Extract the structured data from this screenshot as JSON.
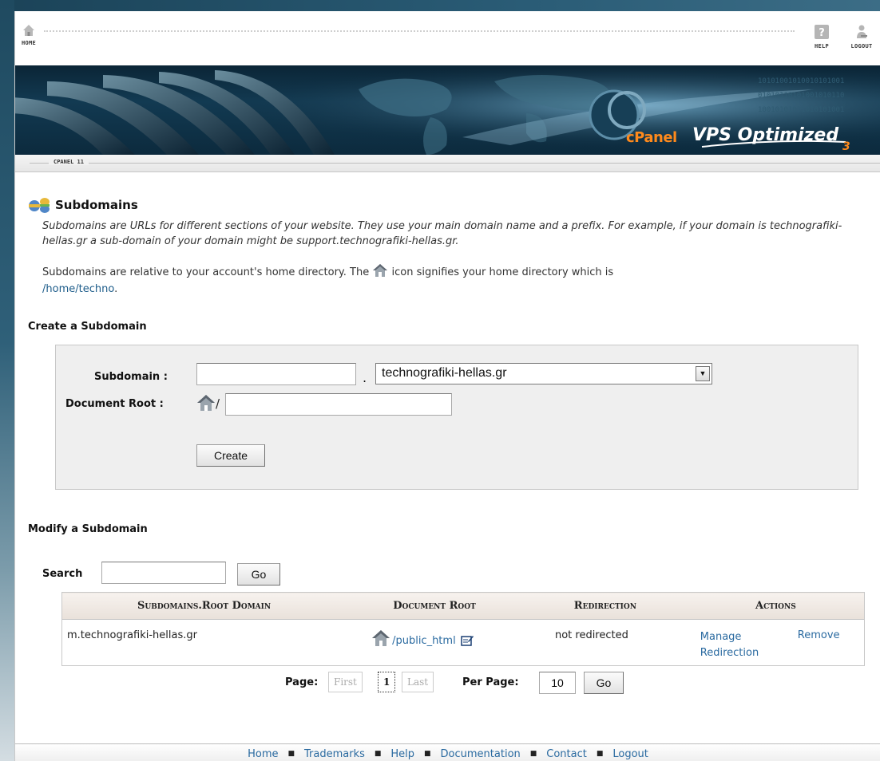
{
  "nav": {
    "home_label": "HOME",
    "help_label": "HELP",
    "logout_label": "LOGOUT"
  },
  "banner": {
    "brand": "cPanel",
    "product": "VPS Optimized",
    "version": "3"
  },
  "version_bar": {
    "label": "CPANEL 11"
  },
  "page": {
    "title": "Subdomains",
    "description": "Subdomains are URLs for different sections of your website. They use your main domain name and a prefix. For example, if your domain is technografiki-hellas.gr a sub-domain of your domain might be support.technografiki-hellas.gr.",
    "home_note_before": "Subdomains are relative to your account's home directory. The",
    "home_note_after": "icon signifies your home directory which is",
    "home_path": "/home/techno",
    "home_path_suffix": "."
  },
  "create": {
    "section_title": "Create a Subdomain",
    "subdomain_label": "Subdomain :",
    "subdomain_value": "",
    "dot": ".",
    "domain_selected": "technografiki-hellas.gr",
    "docroot_label": "Document Root :",
    "docroot_slash": "/",
    "docroot_value": "",
    "create_button": "Create"
  },
  "modify": {
    "section_title": "Modify a Subdomain",
    "search_label": "Search",
    "search_value": "",
    "go_button": "Go",
    "columns": [
      "Subdomains.Root Domain",
      "Document Root",
      "Redirection",
      "Actions"
    ],
    "rows": [
      {
        "subdomain": "m.technografiki-hellas.gr",
        "docroot": "/public_html",
        "redirection": "not redirected",
        "manage": "Manage Redirection",
        "remove": "Remove"
      }
    ]
  },
  "pagination": {
    "page_label": "Page:",
    "first": "First",
    "current": "1",
    "last": "Last",
    "per_page_label": "Per Page:",
    "per_page_value": "10",
    "go_button": "Go"
  },
  "footer": {
    "links": [
      "Home",
      "Trademarks",
      "Help",
      "Documentation",
      "Contact",
      "Logout"
    ]
  },
  "colors": {
    "link": "#2a6aa0",
    "banner_bg": "#123a52",
    "brand_orange": "#ff8a1c",
    "table_header": "#e9e1da"
  }
}
